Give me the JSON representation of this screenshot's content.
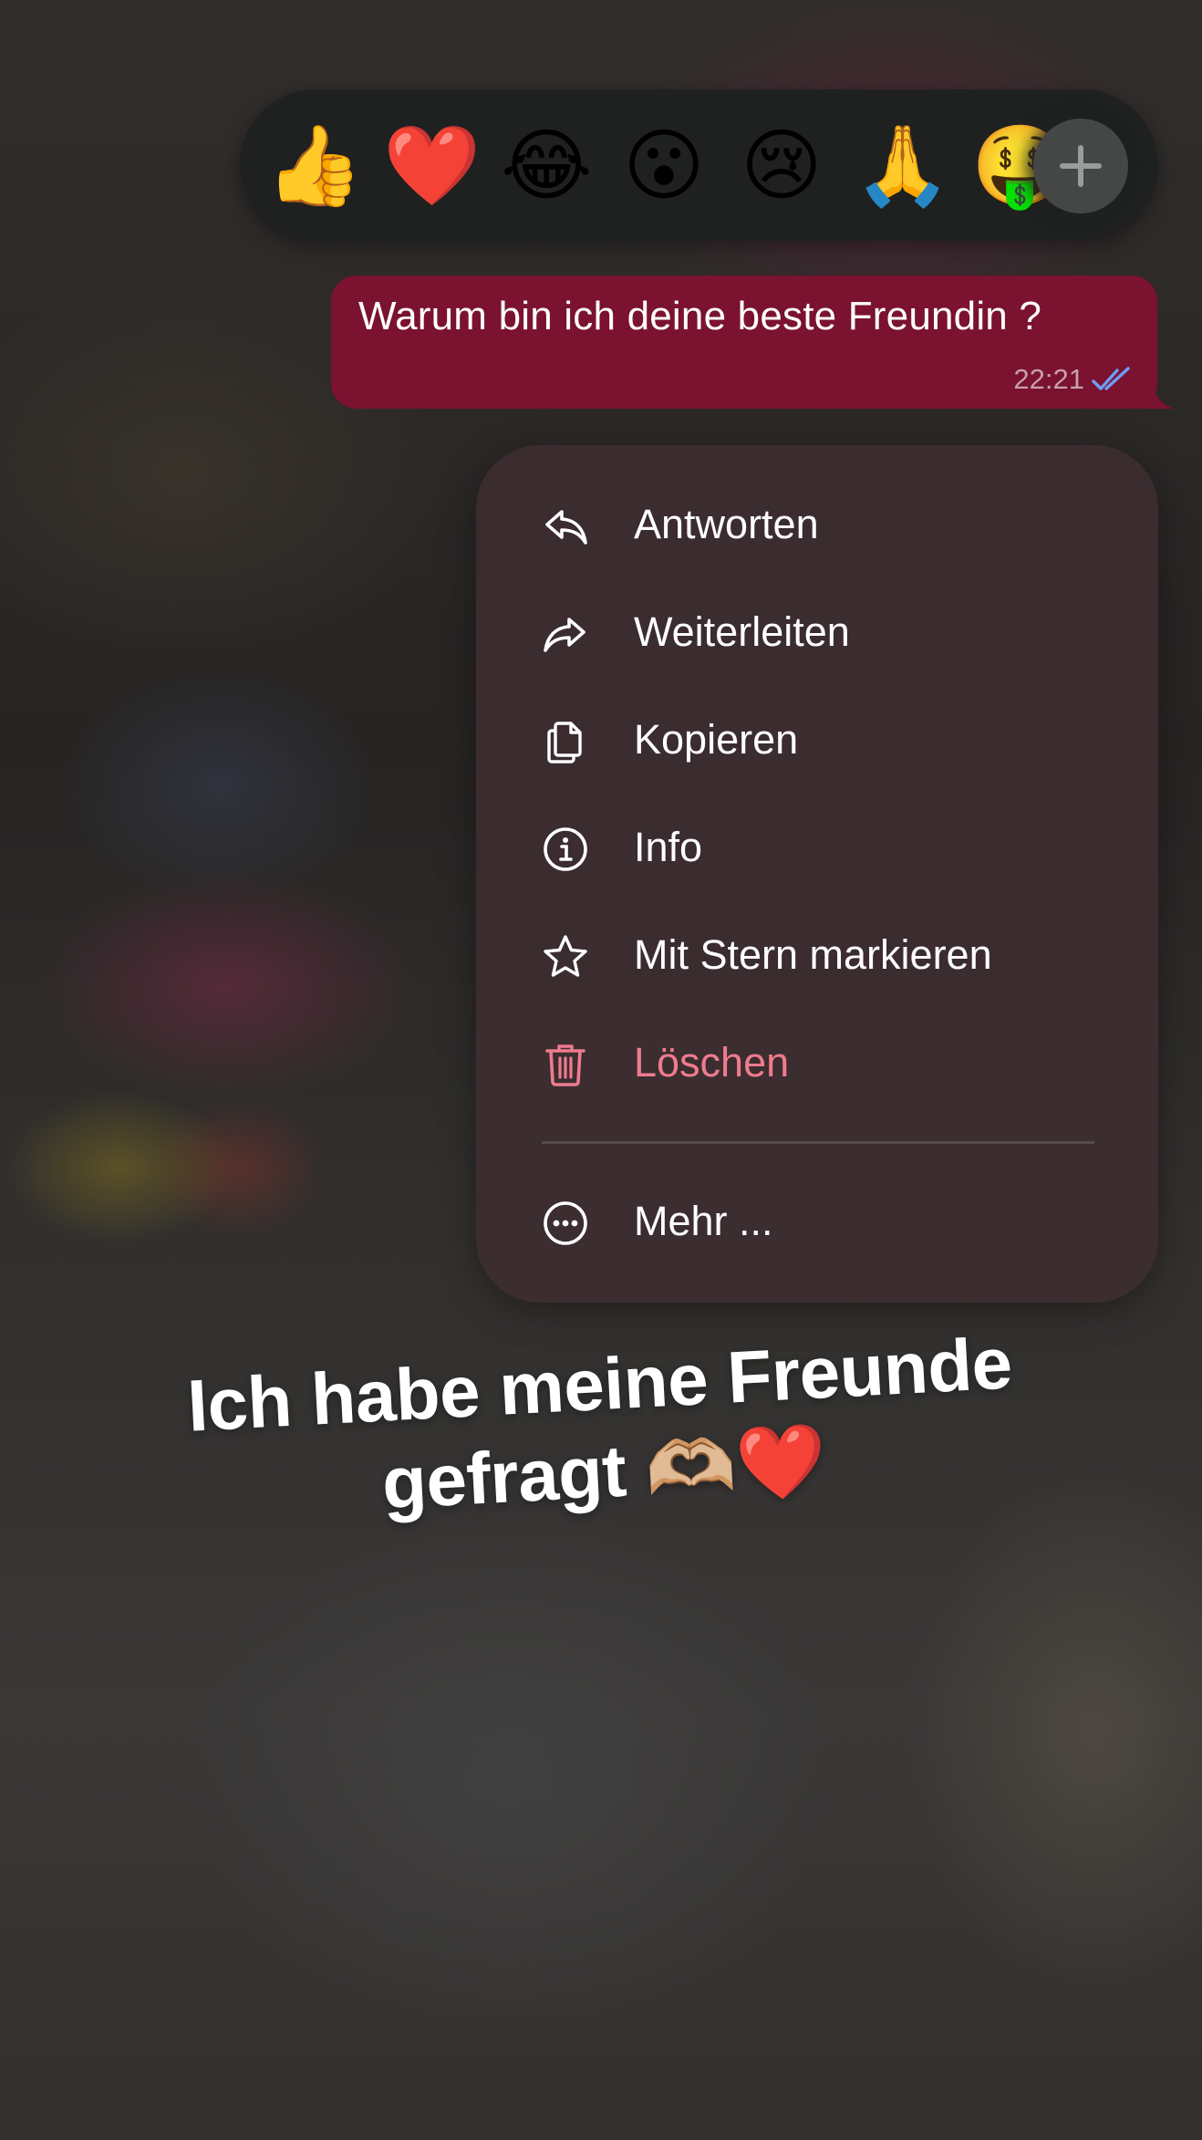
{
  "reactions": {
    "items": [
      {
        "emoji": "👍",
        "icon": "thumbs-up-icon"
      },
      {
        "emoji": "❤️",
        "icon": "red-heart-icon"
      },
      {
        "emoji": "😂",
        "icon": "tears-of-joy-icon"
      },
      {
        "emoji": "😮",
        "icon": "surprised-face-icon"
      },
      {
        "emoji": "😢",
        "icon": "crying-face-icon"
      },
      {
        "emoji": "🙏",
        "icon": "folded-hands-icon"
      },
      {
        "emoji": "🤑",
        "icon": "partially-hidden-emoji-icon"
      }
    ],
    "more_icon": "plus-icon"
  },
  "message": {
    "text": "Warum bin ich deine beste Freundin ?",
    "time": "22:21",
    "status_icon": "double-check-read-icon",
    "bubble_color": "#7a1230",
    "check_color": "#6f9bf5"
  },
  "menu": {
    "items": [
      {
        "label": "Antworten",
        "icon": "reply-icon"
      },
      {
        "label": "Weiterleiten",
        "icon": "forward-icon"
      },
      {
        "label": "Kopieren",
        "icon": "copy-icon"
      },
      {
        "label": "Info",
        "icon": "info-icon"
      },
      {
        "label": "Mit Stern markieren",
        "icon": "star-icon"
      },
      {
        "label": "Löschen",
        "icon": "trash-icon"
      },
      {
        "label": "Mehr ...",
        "icon": "more-icon"
      }
    ],
    "danger_color": "#ef7b8e"
  },
  "caption": {
    "line1": "Ich habe meine Freunde",
    "line2": "gefragt 🫶🏼❤️"
  }
}
